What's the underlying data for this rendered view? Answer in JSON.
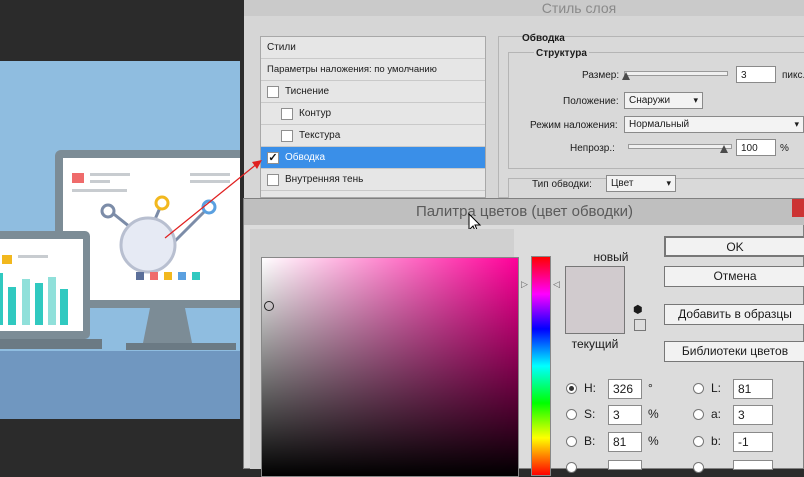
{
  "layer_style": {
    "title": "Стиль слоя",
    "styles_header": "Стили",
    "blend_options": "Параметры наложения: по умолчанию",
    "items": [
      {
        "label": "Тиснение",
        "checked": false
      },
      {
        "label": "Контур",
        "checked": false
      },
      {
        "label": "Текстура",
        "checked": false
      },
      {
        "label": "Обводка",
        "checked": true
      },
      {
        "label": "Внутренняя тень",
        "checked": false
      }
    ],
    "stroke": {
      "section": "Обводка",
      "structure": "Структура",
      "size_label": "Размер:",
      "size_value": "3",
      "size_unit": "пикс.",
      "position_label": "Положение:",
      "position_value": "Снаружи",
      "blend_label": "Режим наложения:",
      "blend_value": "Нормальный",
      "opacity_label": "Непрозр.:",
      "opacity_value": "100",
      "opacity_unit": "%",
      "fill_type_label": "Тип обводки:",
      "fill_type_value": "Цвет"
    }
  },
  "color_picker": {
    "title": "Палитра цветов (цвет обводки)",
    "new_label": "новый",
    "current_label": "текущий",
    "ok": "OK",
    "cancel": "Отмена",
    "add_swatches": "Добавить в образцы",
    "libraries": "Библиотеки цветов",
    "swatch_color": "#d1cbce",
    "fields_left": [
      {
        "label": "H:",
        "value": "326",
        "unit": "°",
        "selected": true
      },
      {
        "label": "S:",
        "value": "3",
        "unit": "%",
        "selected": false
      },
      {
        "label": "B:",
        "value": "81",
        "unit": "%",
        "selected": false
      }
    ],
    "fields_right": [
      {
        "label": "L:",
        "value": "81"
      },
      {
        "label": "a:",
        "value": "3"
      },
      {
        "label": "b:",
        "value": "-1"
      }
    ]
  },
  "colors": {
    "selection": "#3a8fe8",
    "annotation_arrow": "#e02020"
  }
}
